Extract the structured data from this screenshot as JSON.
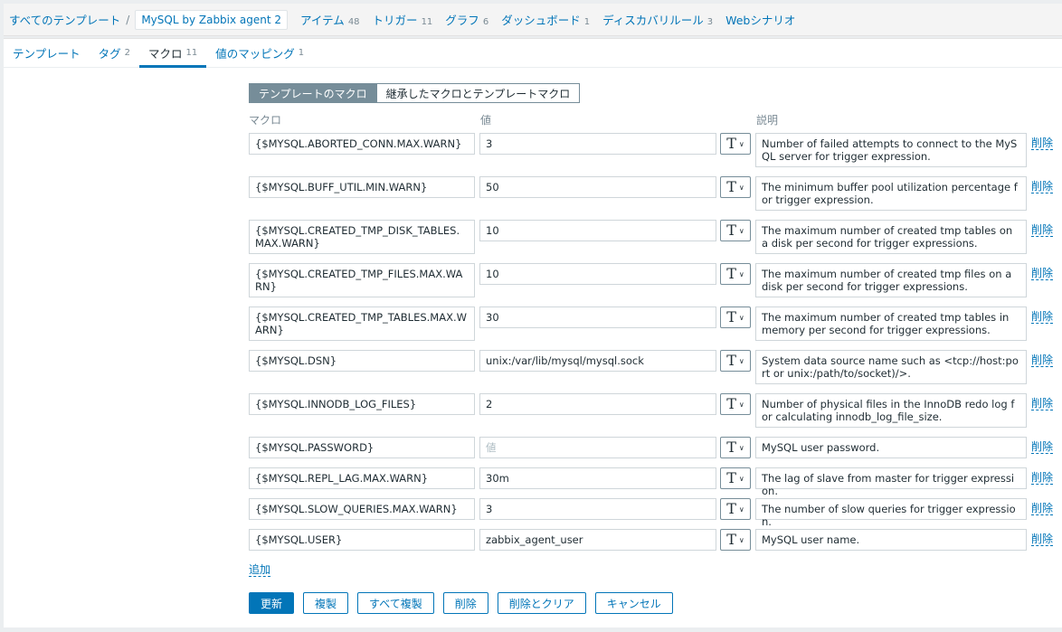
{
  "breadcrumb": {
    "all_templates": "すべてのテンプレート",
    "separator": "/",
    "current_template": "MySQL by Zabbix agent 2",
    "items": [
      {
        "label": "アイテム",
        "count": "48"
      },
      {
        "label": "トリガー",
        "count": "11"
      },
      {
        "label": "グラフ",
        "count": "6"
      },
      {
        "label": "ダッシュボード",
        "count": "1"
      },
      {
        "label": "ディスカバリルール",
        "count": "3"
      },
      {
        "label": "Webシナリオ",
        "count": ""
      }
    ]
  },
  "tabs": [
    {
      "label": "テンプレート",
      "count": ""
    },
    {
      "label": "タグ",
      "count": "2"
    },
    {
      "label": "マクロ",
      "count": "11",
      "active": true
    },
    {
      "label": "値のマッピング",
      "count": "1"
    }
  ],
  "macro_toggle": {
    "template_macros": "テンプレートのマクロ",
    "inherited_macros": "継承したマクロとテンプレートマクロ"
  },
  "columns": {
    "macro": "マクロ",
    "value": "値",
    "description": "説明"
  },
  "value_type_icon": "text-type-T-icon",
  "value_placeholder": "値",
  "delete_label": "削除",
  "macros": [
    {
      "macro": "{$MYSQL.ABORTED_CONN.MAX.WARN}",
      "value": "3",
      "description": "Number of failed attempts to connect to the MySQL server for trigger expression."
    },
    {
      "macro": "{$MYSQL.BUFF_UTIL.MIN.WARN}",
      "value": "50",
      "description": "The minimum buffer pool utilization percentage for trigger expression."
    },
    {
      "macro": "{$MYSQL.CREATED_TMP_DISK_TABLES.MAX.WARN}",
      "value": "10",
      "description": "The maximum number of created tmp tables on a disk per second for trigger expressions."
    },
    {
      "macro": "{$MYSQL.CREATED_TMP_FILES.MAX.WARN}",
      "value": "10",
      "description": "The maximum number of created tmp files on a disk per second for trigger expressions."
    },
    {
      "macro": "{$MYSQL.CREATED_TMP_TABLES.MAX.WARN}",
      "value": "30",
      "description": "The maximum number of created tmp tables in memory per second for trigger expressions."
    },
    {
      "macro": "{$MYSQL.DSN}",
      "value": "unix:/var/lib/mysql/mysql.sock",
      "description": "System data source name such as <tcp://host:port or unix:/path/to/socket)/>."
    },
    {
      "macro": "{$MYSQL.INNODB_LOG_FILES}",
      "value": "2",
      "description": "Number of physical files in the InnoDB redo log for calculating innodb_log_file_size."
    },
    {
      "macro": "{$MYSQL.PASSWORD}",
      "value": "",
      "description": "MySQL user password."
    },
    {
      "macro": "{$MYSQL.REPL_LAG.MAX.WARN}",
      "value": "30m",
      "description": "The lag of slave from master for trigger expression."
    },
    {
      "macro": "{$MYSQL.SLOW_QUERIES.MAX.WARN}",
      "value": "3",
      "description": "The number of slow queries for trigger expression."
    },
    {
      "macro": "{$MYSQL.USER}",
      "value": "zabbix_agent_user",
      "description": "MySQL user name."
    }
  ],
  "add_label": "追加",
  "actions": {
    "update": "更新",
    "clone": "複製",
    "full_clone": "すべて複製",
    "delete": "削除",
    "delete_and_clear": "削除とクリア",
    "cancel": "キャンセル"
  }
}
